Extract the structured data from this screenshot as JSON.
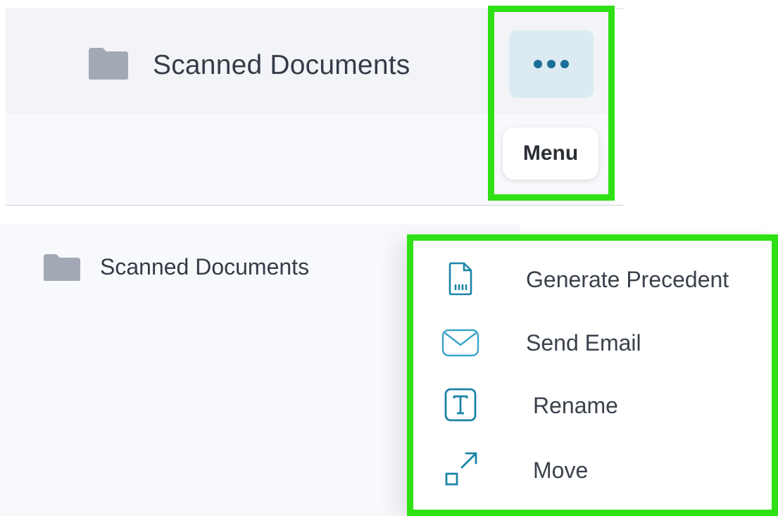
{
  "top": {
    "folder_name": "Scanned Documents",
    "more_icon": "ellipsis-icon",
    "tooltip": "Menu"
  },
  "bottom": {
    "folder_name": "Scanned Documents",
    "menu": {
      "items": [
        {
          "label": "Generate Precedent",
          "icon": "document-generate-icon"
        },
        {
          "label": "Send Email",
          "icon": "envelope-icon"
        },
        {
          "label": "Rename",
          "icon": "text-rename-icon"
        },
        {
          "label": "Move",
          "icon": "move-arrow-icon"
        }
      ]
    }
  },
  "colors": {
    "highlight": "#2ee014",
    "accent": "#1a84a8",
    "folder": "#a3a9b4",
    "row_bg": "#f3f4f7",
    "button_bg": "#dcebf2"
  }
}
